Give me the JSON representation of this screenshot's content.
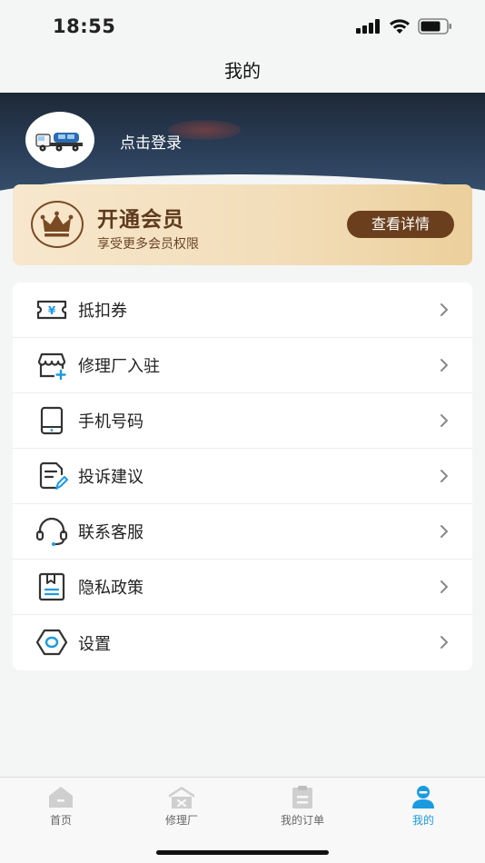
{
  "status_bar": {
    "time": "18:55"
  },
  "nav": {
    "title": "我的"
  },
  "profile": {
    "login_text": "点击登录"
  },
  "vip": {
    "title": "开通会员",
    "subtitle": "享受更多会员权限",
    "button": "查看详情"
  },
  "menu": {
    "items": [
      {
        "label": "抵扣券",
        "icon": "coupon-icon"
      },
      {
        "label": "修理厂入驻",
        "icon": "shop-add-icon"
      },
      {
        "label": "手机号码",
        "icon": "phone-icon"
      },
      {
        "label": "投诉建议",
        "icon": "feedback-icon"
      },
      {
        "label": "联系客服",
        "icon": "headset-icon"
      },
      {
        "label": "隐私政策",
        "icon": "privacy-icon"
      },
      {
        "label": "设置",
        "icon": "gear-icon"
      }
    ]
  },
  "tabs": [
    {
      "label": "首页",
      "icon": "home-icon"
    },
    {
      "label": "修理厂",
      "icon": "repair-shop-icon"
    },
    {
      "label": "我的订单",
      "icon": "orders-icon"
    },
    {
      "label": "我的",
      "icon": "profile-icon",
      "active": true
    }
  ],
  "colors": {
    "accent": "#1a9be0",
    "vip_brown": "#6b3f1d",
    "icon_blue": "#1a9be0"
  }
}
